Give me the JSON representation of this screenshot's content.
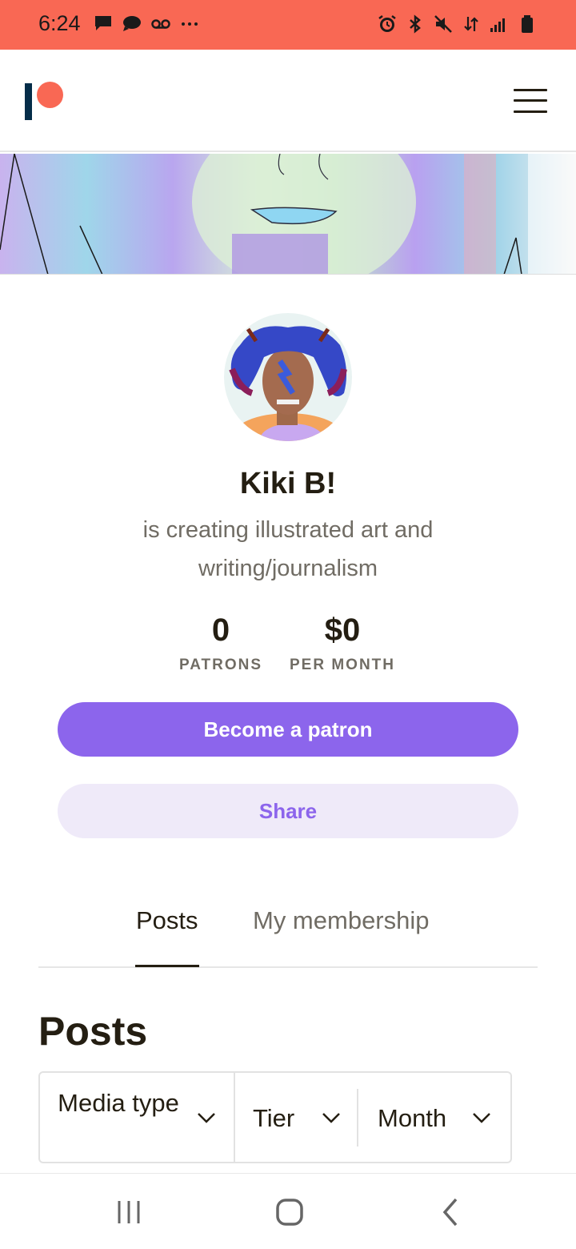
{
  "status_bar": {
    "time": "6:24",
    "left_icons": [
      "message-icon",
      "chat-icon",
      "voicemail-icon",
      "more-dots-icon"
    ],
    "right_icons": [
      "alarm-icon",
      "bluetooth-icon",
      "mute-icon",
      "data-arrows-icon",
      "signal-icon",
      "battery-icon"
    ],
    "background_color": "#f96854"
  },
  "header": {
    "logo": "patreon-logo",
    "menu_icon": "hamburger-menu-icon"
  },
  "profile": {
    "name": "Kiki B!",
    "description": "is creating illustrated art and writing/journalism",
    "stats": [
      {
        "value": "0",
        "label": "PATRONS"
      },
      {
        "value": "$0",
        "label": "PER MONTH"
      }
    ]
  },
  "actions": {
    "become_patron": "Become a patron",
    "share": "Share",
    "primary_color": "#8c65ec"
  },
  "tabs": [
    {
      "label": "Posts",
      "selected": true
    },
    {
      "label": "My membership",
      "selected": false
    }
  ],
  "posts": {
    "heading": "Posts",
    "filters": [
      {
        "label": "Media type"
      },
      {
        "label": "Tier"
      },
      {
        "label": "Month"
      }
    ]
  },
  "nav_bar": {
    "buttons": [
      "recents-icon",
      "home-icon",
      "back-icon"
    ]
  }
}
